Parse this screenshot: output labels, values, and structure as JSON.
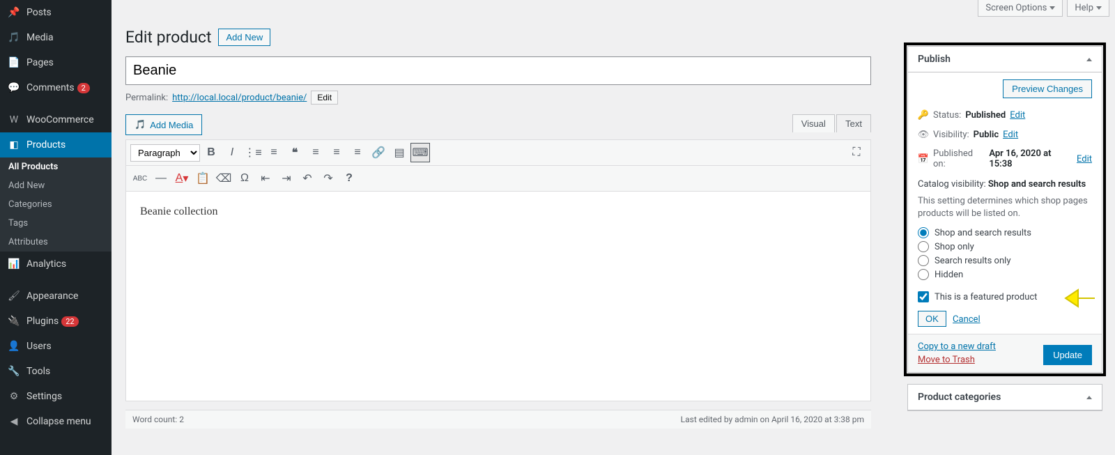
{
  "sidebar": {
    "items": [
      {
        "icon": "pin",
        "label": "Posts"
      },
      {
        "icon": "media",
        "label": "Media"
      },
      {
        "icon": "page",
        "label": "Pages"
      },
      {
        "icon": "comment",
        "label": "Comments",
        "badge": "2"
      },
      {
        "icon": "woo",
        "label": "WooCommerce"
      },
      {
        "icon": "products",
        "label": "Products",
        "active": true
      },
      {
        "icon": "analytics",
        "label": "Analytics"
      },
      {
        "icon": "appearance",
        "label": "Appearance"
      },
      {
        "icon": "plugins",
        "label": "Plugins",
        "badge": "22"
      },
      {
        "icon": "users",
        "label": "Users"
      },
      {
        "icon": "tools",
        "label": "Tools"
      },
      {
        "icon": "settings",
        "label": "Settings"
      },
      {
        "icon": "collapse",
        "label": "Collapse menu"
      }
    ],
    "submenu": [
      "All Products",
      "Add New",
      "Categories",
      "Tags",
      "Attributes"
    ]
  },
  "toptabs": {
    "screen_options": "Screen Options",
    "help": "Help"
  },
  "page": {
    "heading": "Edit product",
    "add_new": "Add New",
    "title_value": "Beanie",
    "permalink_label": "Permalink:",
    "permalink_url": "http://local.local/product/beanie/",
    "permalink_edit": "Edit",
    "add_media": "Add Media",
    "tabs": {
      "visual": "Visual",
      "text": "Text"
    },
    "format_select": "Paragraph",
    "body": "Beanie collection",
    "word_count_label": "Word count:",
    "word_count": "2",
    "last_edited": "Last edited by admin on April 16, 2020 at 3:38 pm"
  },
  "publish": {
    "title": "Publish",
    "preview": "Preview Changes",
    "status_label": "Status:",
    "status_value": "Published",
    "edit": "Edit",
    "visibility_label": "Visibility:",
    "visibility_value": "Public",
    "published_label": "Published on:",
    "published_value": "Apr 16, 2020 at 15:38",
    "catalog_label": "Catalog visibility:",
    "catalog_value": "Shop and search results",
    "help": "This setting determines which shop pages products will be listed on.",
    "radios": [
      "Shop and search results",
      "Shop only",
      "Search results only",
      "Hidden"
    ],
    "featured": "This is a featured product",
    "ok": "OK",
    "cancel": "Cancel",
    "copy": "Copy to a new draft",
    "trash": "Move to Trash",
    "update": "Update"
  },
  "categories_box": {
    "title": "Product categories"
  }
}
